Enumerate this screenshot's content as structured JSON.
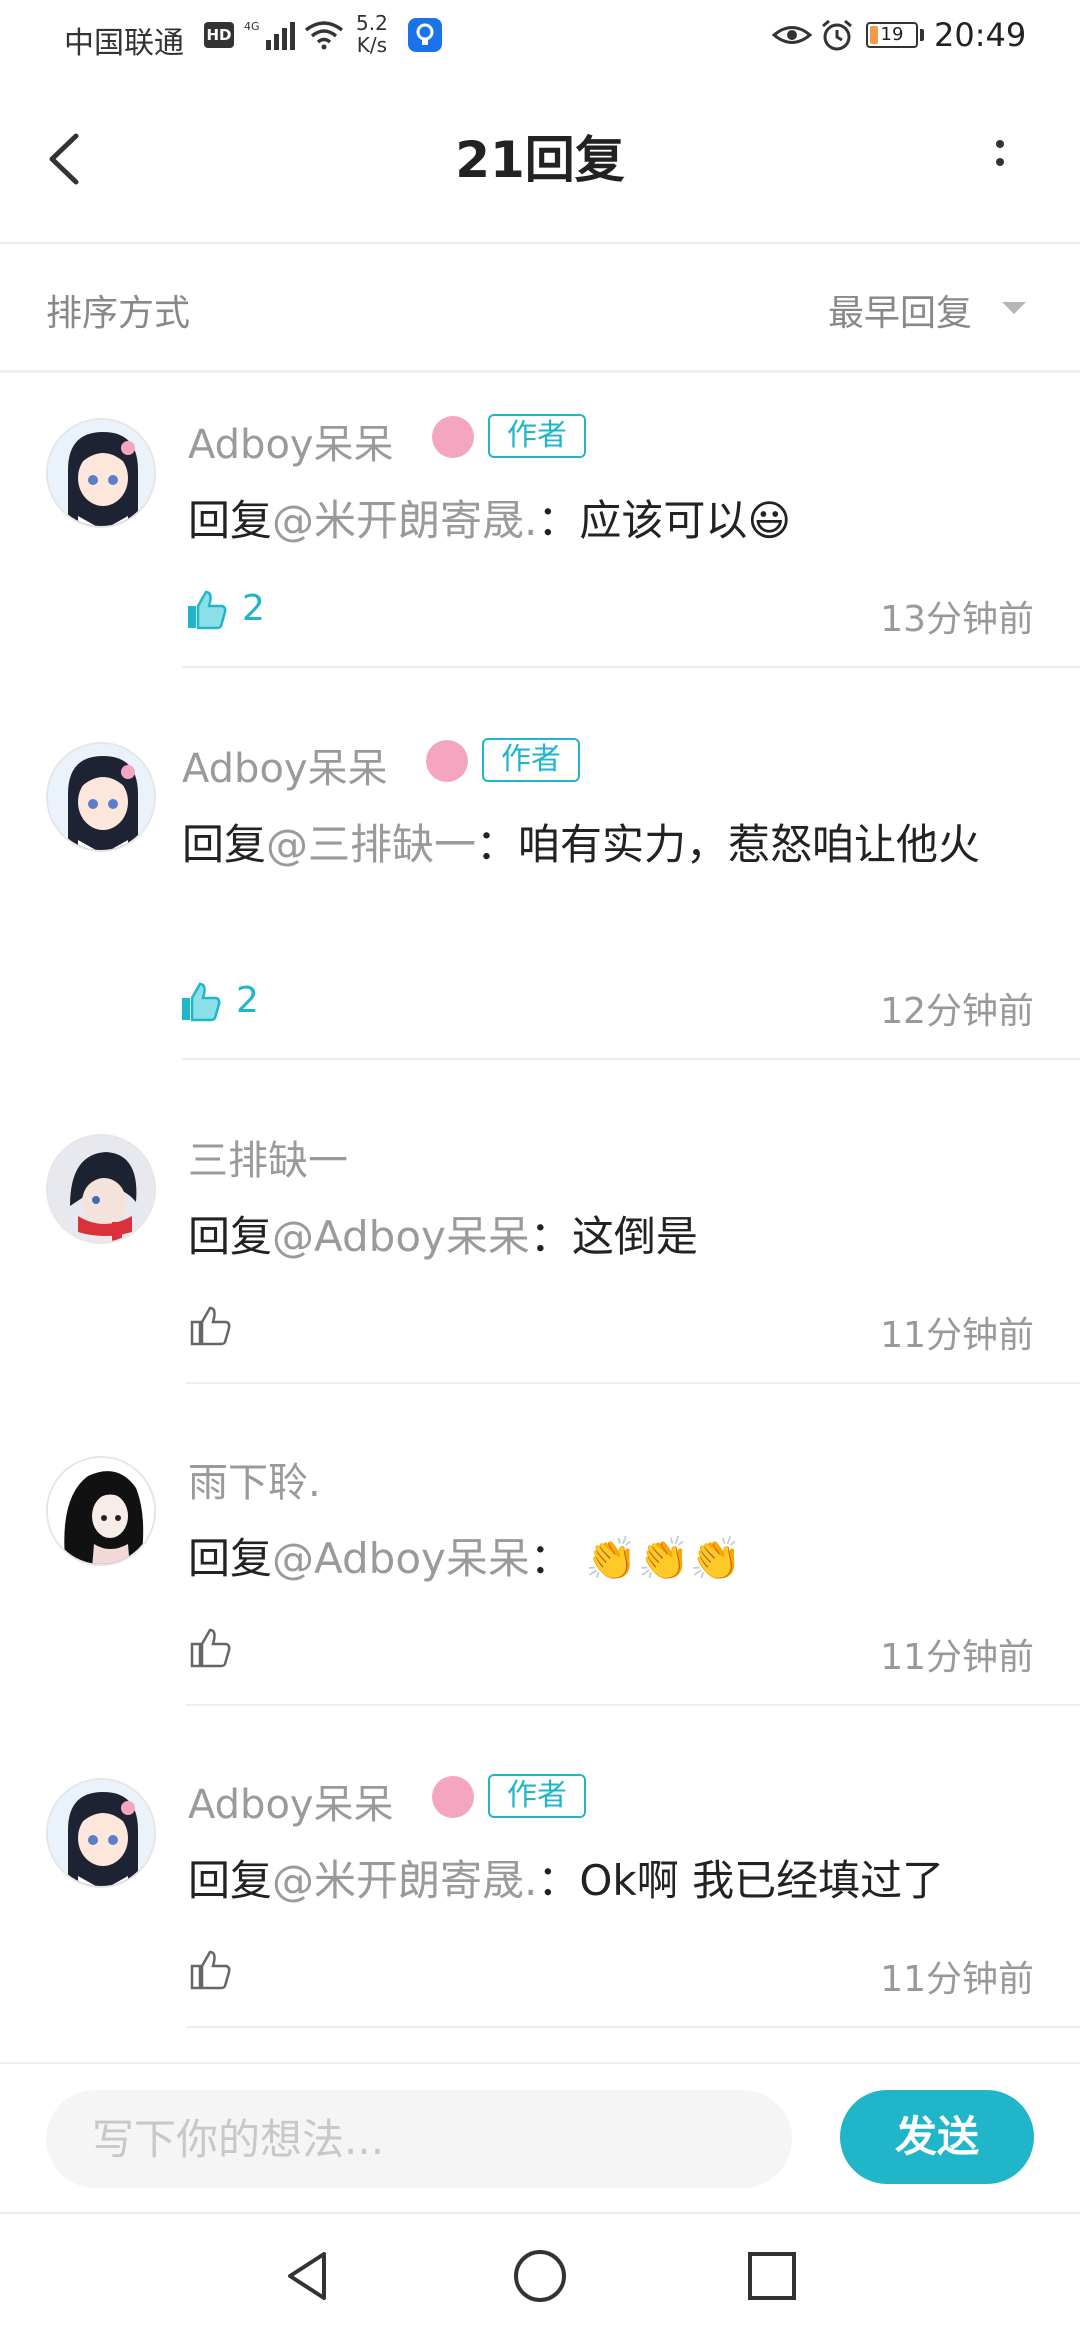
{
  "status_bar": {
    "carrier": "中国联通",
    "hd_badge": "HD",
    "network_speed": "5.2",
    "network_speed_unit": "K/s",
    "battery": "19",
    "battery_fraction": 0.19,
    "time": "20:49"
  },
  "header": {
    "title": "21回复"
  },
  "sort": {
    "label": "排序方式",
    "value": "最早回复"
  },
  "comments": [
    {
      "username": "Adboy呆呆",
      "is_author": true,
      "author_badge": "作者",
      "reply_prefix": "回复",
      "mention": "@米开朗寄晟.",
      "text": "：应该可以😃",
      "likes": "2",
      "liked": true,
      "time": "13分钟前"
    },
    {
      "username": "Adboy呆呆",
      "is_author": true,
      "author_badge": "作者",
      "reply_prefix": "回复",
      "mention": "@三排缺一",
      "text": "：咱有实力，惹怒咱让他火",
      "likes": "2",
      "liked": true,
      "time": "12分钟前"
    },
    {
      "username": "三排缺一",
      "is_author": false,
      "reply_prefix": "回复",
      "mention": "@Adboy呆呆",
      "text": "：这倒是",
      "likes": "",
      "liked": false,
      "time": "11分钟前"
    },
    {
      "username": "雨下聆.",
      "is_author": false,
      "reply_prefix": "回复",
      "mention": "@Adboy呆呆",
      "text": "： 👏👏👏",
      "likes": "",
      "liked": false,
      "time": "11分钟前"
    },
    {
      "username": "Adboy呆呆",
      "is_author": true,
      "author_badge": "作者",
      "reply_prefix": "回复",
      "mention": "@米开朗寄晟.",
      "text": "：Ok啊 我已经填过了",
      "likes": "",
      "liked": false,
      "time": "11分钟前"
    }
  ],
  "reply_box": {
    "placeholder": "写下你的想法...",
    "value": "",
    "send_label": "发送"
  },
  "colors": {
    "accent": "#20b5c9",
    "muted_text": "#9a9a9a",
    "divider": "#eeeeee"
  },
  "icons": {
    "back": "chevron-left-icon",
    "more": "more-vertical-icon",
    "like": "thumbs-up-icon",
    "level": "level-badge-icon",
    "nav_back": "triangle-back-icon",
    "nav_home": "circle-home-icon",
    "nav_recents": "square-recents-icon"
  }
}
